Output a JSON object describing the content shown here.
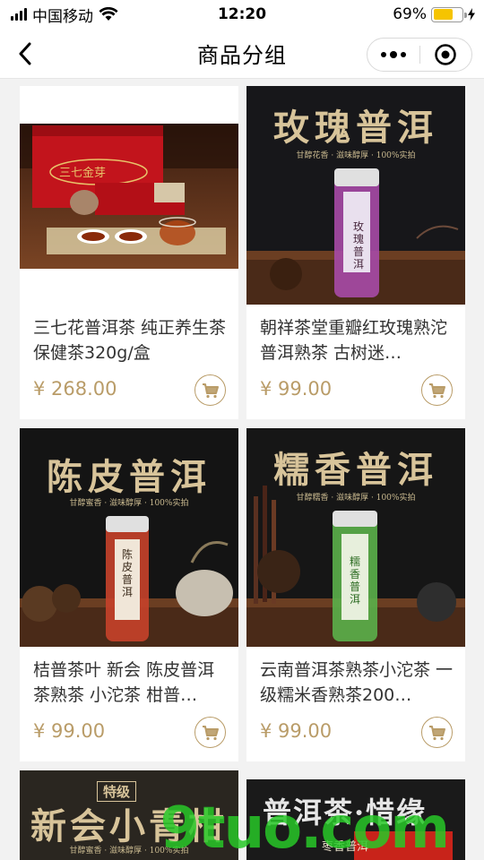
{
  "status_bar": {
    "carrier": "中国移动",
    "time": "12:20",
    "battery": "69%",
    "battery_level": 0.69
  },
  "nav": {
    "title": "商品分组"
  },
  "products": [
    {
      "title": "三七花普洱茶 纯正养生茶 保健茶320g/盒",
      "price": "¥ 268.00",
      "image": {
        "headline": "",
        "tagline": "",
        "label": "三七金芽"
      }
    },
    {
      "title": "朝祥茶堂重瓣红玫瑰熟沱 普洱熟茶 古树迷…",
      "price": "¥ 99.00",
      "image": {
        "headline": "玫瑰普洱",
        "tagline": "甘醇花香 · 滋味醇厚 · 100%实拍",
        "label": "玫瑰普洱"
      }
    },
    {
      "title": "桔普茶叶 新会 陈皮普洱茶熟茶 小沱茶 柑普…",
      "price": "¥ 99.00",
      "image": {
        "headline": "陈皮普洱",
        "tagline": "甘醇蜜香 · 滋味醇厚 · 100%实拍",
        "label": "陈皮普洱"
      }
    },
    {
      "title": "云南普洱茶熟茶小沱茶 一级糯米香熟茶200…",
      "price": "¥ 99.00",
      "image": {
        "headline": "糯香普洱",
        "tagline": "甘醇糯香 · 滋味醇厚 · 100%实拍",
        "label": "糯香普洱"
      }
    },
    {
      "image": {
        "headline": "新会小青柑",
        "tagline": "甘醇蜜香 · 滋味醇厚 · 100%实拍",
        "badge": "特级"
      }
    },
    {
      "image": {
        "headline": "普洱茶·惜缘",
        "tagline": "枣香普洱"
      }
    }
  ],
  "watermark": "9tuo.com",
  "colors": {
    "price": "#b99c68",
    "battery": "#f6c400",
    "background": "#f2f2f2"
  },
  "icons": [
    "signal-icon",
    "wifi-icon",
    "battery-icon",
    "charging-bolt-icon",
    "back-arrow-icon",
    "more-dots-icon",
    "close-target-icon",
    "cart-icon"
  ]
}
